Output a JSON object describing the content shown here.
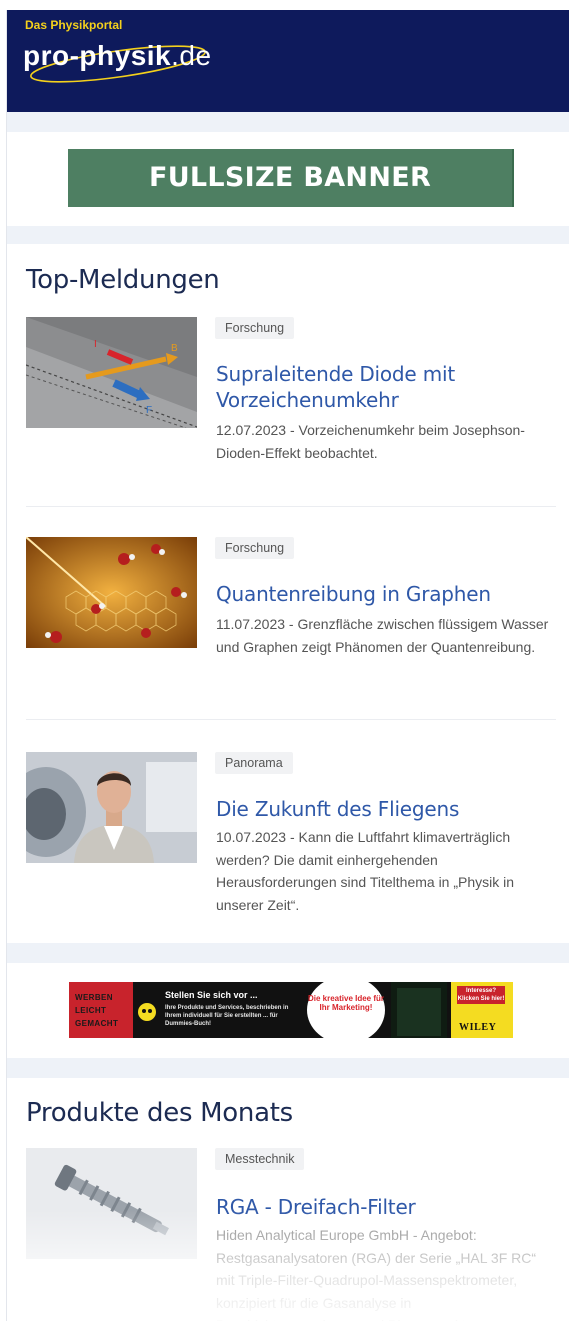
{
  "header": {
    "tagline": "Das Physikportal",
    "logo_main": "pro-physik",
    "logo_tld": ".de",
    "bg_color": "#0e1a5c",
    "tagline_color": "#f4d11c"
  },
  "banner": {
    "label": "FULLSIZE BANNER",
    "bg_color": "#4e7f62"
  },
  "top_news": {
    "title": "Top-Meldungen",
    "articles": [
      {
        "tag": "Forschung",
        "title": "Supraleitende Diode mit Vorzeichenumkehr",
        "description": "12.07.2023 - Vorzeichenumkehr beim Josephson-Dioden-Effekt beobachtet.",
        "image": "superconducting-diode-image"
      },
      {
        "tag": "Forschung",
        "title": "Quantenreibung in Graphen",
        "description": "11.07.2023 - Grenzfläche zwischen flüssigem Wasser und Graphen zeigt Phänomen der Quantenreibung.",
        "image": "graphene-water-image"
      },
      {
        "tag": "Panorama",
        "title": "Die Zukunft des Fliegens",
        "description": "10.07.2023 - Kann die Luftfahrt klimaverträglich werden? Die damit einhergehenden Herausforderungen sind Titelthema in „Physik in unserer Zeit“.",
        "image": "person-portrait-image"
      }
    ]
  },
  "ad": {
    "red_lines": [
      "WERBEN",
      "LEICHT",
      "GEMACHT"
    ],
    "headline": "Stellen Sie sich vor ...",
    "body": "Ihre Produkte und Services, beschrieben in Ihrem individuell für Sie erstellten ... für Dummies-Buch!",
    "bubble": "Die kreative Idee für Ihr Marketing!",
    "yellow_box": "Interesse? Klicken Sie hier!",
    "brand": "WILEY"
  },
  "products": {
    "title": "Produkte des Monats",
    "items": [
      {
        "tag": "Messtechnik",
        "title": "RGA - Dreifach-Filter",
        "description": "Hiden Analytical Europe GmbH - Angebot: Restgasanalysatoren (RGA) der Serie „HAL 3F RC“ mit Triple-Filter-Quadrupol-Massenspektrometer, konzipiert für die Gasanalyse in Beschichtungsanlagen und Plasmareaktoren.",
        "image": "rga-filter-image"
      }
    ]
  }
}
